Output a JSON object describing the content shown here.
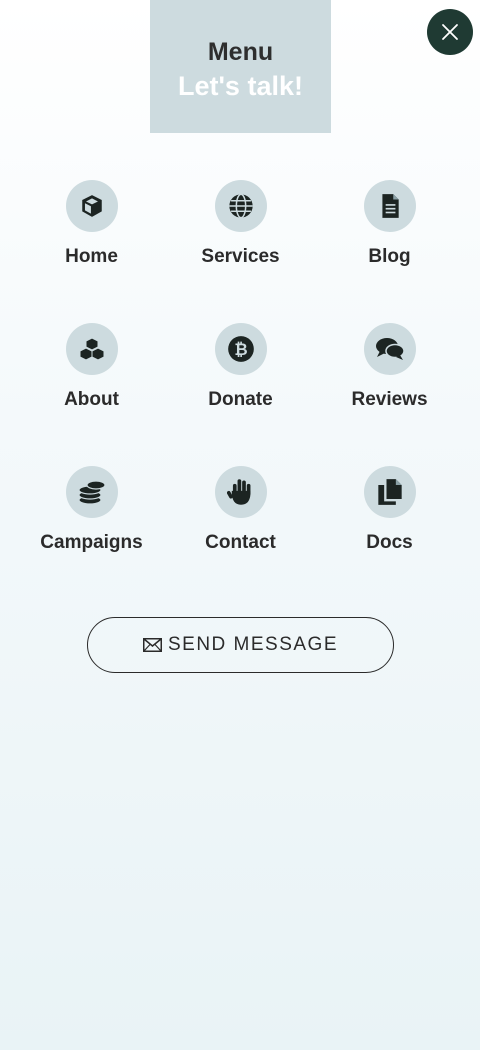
{
  "header": {
    "title": "Menu",
    "subtitle": "Let's talk!"
  },
  "close": {
    "icon": "close-icon"
  },
  "menu_items": [
    {
      "label": "Home",
      "icon": "cube-icon"
    },
    {
      "label": "Services",
      "icon": "globe-icon"
    },
    {
      "label": "Blog",
      "icon": "document-icon"
    },
    {
      "label": "About",
      "icon": "cubes-icon"
    },
    {
      "label": "Donate",
      "icon": "bitcoin-icon"
    },
    {
      "label": "Reviews",
      "icon": "comments-icon"
    },
    {
      "label": "Campaigns",
      "icon": "coins-icon"
    },
    {
      "label": "Contact",
      "icon": "hand-wave-icon"
    },
    {
      "label": "Docs",
      "icon": "copy-icon"
    }
  ],
  "send_button": {
    "label": "SEND MESSAGE",
    "icon": "envelope-icon"
  },
  "colors": {
    "accent_dark": "#1f3a33",
    "icon_bg": "#cddbdf",
    "text": "#2b2b2b"
  }
}
